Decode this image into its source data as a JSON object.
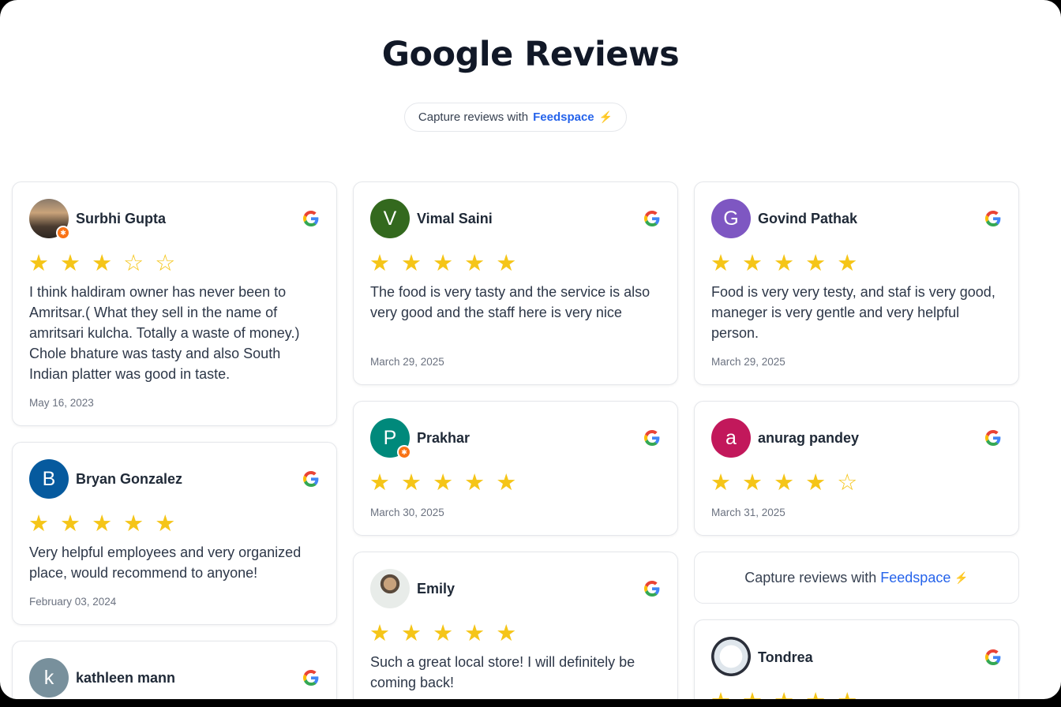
{
  "page": {
    "title": "Google Reviews"
  },
  "capture": {
    "prefix": "Capture reviews with",
    "brand": "Feedspace",
    "bolt": "⚡"
  },
  "colors": {
    "star": "#f5c518",
    "brand": "#2563eb"
  },
  "reviews": [
    {
      "name": "Surbhi Gupta",
      "avatar": "photo",
      "local_guide": true,
      "rating": 3,
      "stars": "★ ★ ★ ☆ ☆",
      "text": "I think haldiram owner has never been to Amritsar.( What they sell in the name of amritsari kulcha. Totally a waste of money.) Chole bhature was tasty and also South Indian platter was good in taste.",
      "date": "May 16, 2023"
    },
    {
      "name": "Bryan Gonzalez",
      "avatar_letter": "B",
      "avatar_color": "#065a9e",
      "rating": 5,
      "stars": "★ ★ ★ ★ ★",
      "text": "Very helpful employees and very organized place, would recommend to anyone!",
      "date": "February 03, 2024"
    },
    {
      "name": "kathleen mann",
      "avatar_letter": "k",
      "avatar_color": "#78909c"
    },
    {
      "name": "Vimal Saini",
      "avatar_letter": "V",
      "avatar_color": "#33691e",
      "rating": 5,
      "stars": "★ ★ ★ ★ ★",
      "text": "The food is very tasty and the service is also very good and the staff here is very nice",
      "date": "March 29, 2025"
    },
    {
      "name": "Prakhar",
      "avatar_letter": "P",
      "avatar_color": "#00897b",
      "local_guide": true,
      "rating": 5,
      "stars": "★ ★ ★ ★ ★",
      "date": "March 30, 2025"
    },
    {
      "name": "Emily",
      "avatar": "photo",
      "rating": 5,
      "stars": "★ ★ ★ ★ ★",
      "text": "Such a great local store! I will definitely be coming back!"
    },
    {
      "name": "Govind Pathak",
      "avatar_letter": "G",
      "avatar_color": "#7e57c2",
      "rating": 5,
      "stars": "★ ★ ★ ★ ★",
      "text": "Food is very very testy, and staf is very good, maneger is very gentle and very helpful person.",
      "date": "March 29, 2025"
    },
    {
      "name": "anurag pandey",
      "avatar_letter": "a",
      "avatar_color": "#c2185b",
      "rating": 4,
      "stars": "★ ★ ★ ★ ☆",
      "date": "March 31, 2025"
    },
    {
      "name": "Tondrea",
      "avatar": "photo",
      "stars": "★ ★ ★ ★ ★"
    }
  ]
}
